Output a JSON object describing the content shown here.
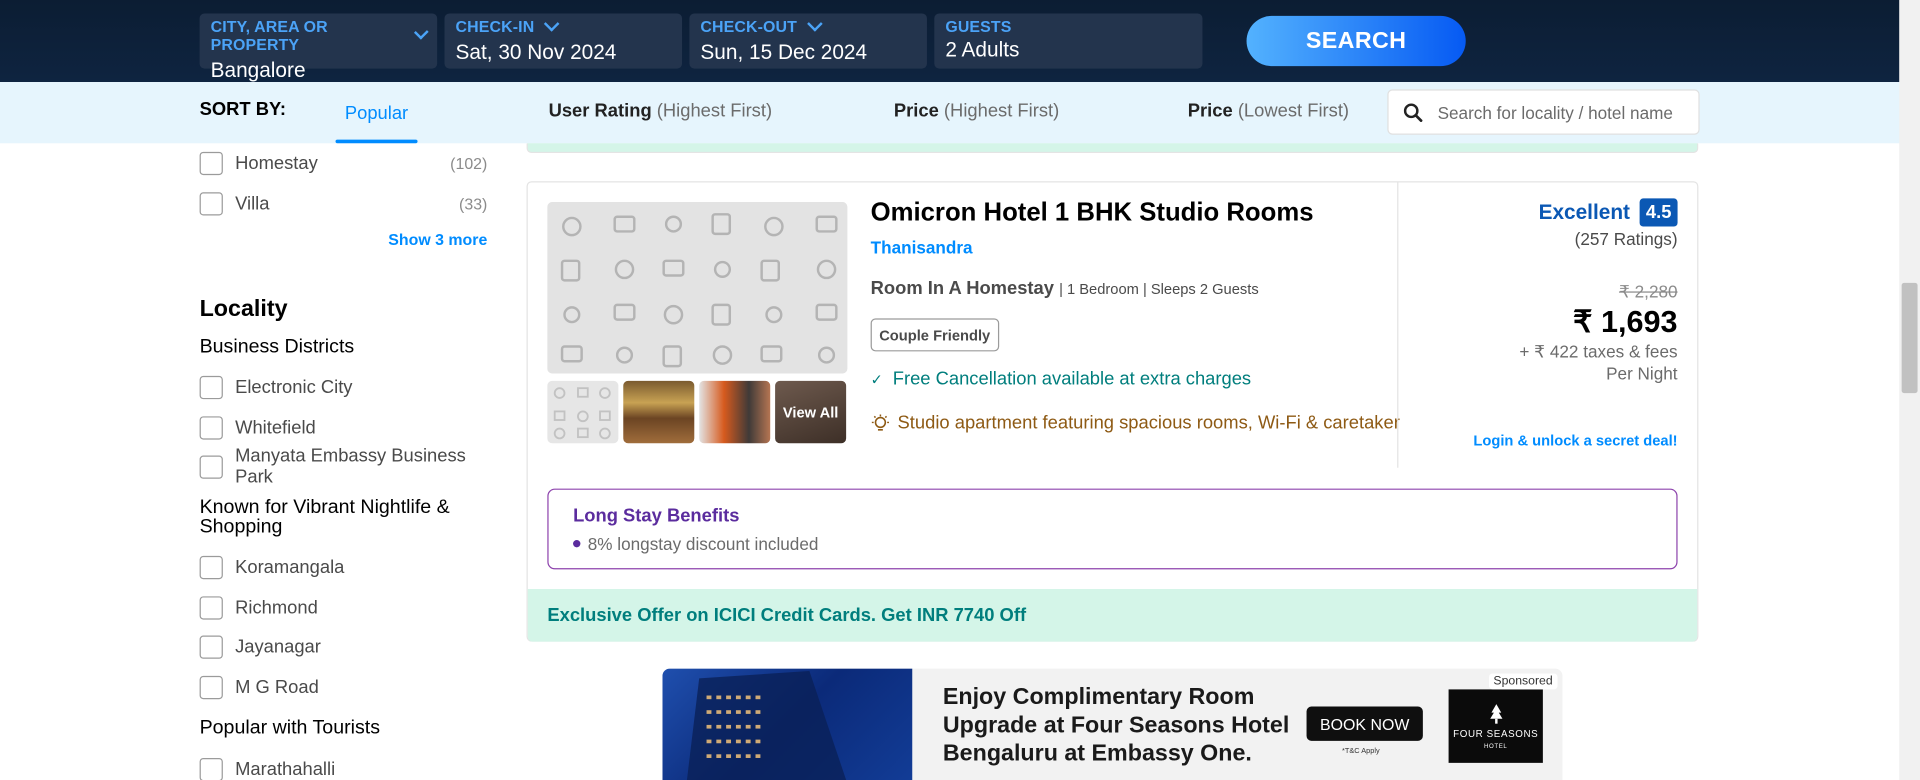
{
  "search_bar": {
    "city": {
      "label": "CITY, AREA OR PROPERTY",
      "value": "Bangalore"
    },
    "checkin": {
      "label": "CHECK-IN",
      "value": "Sat, 30 Nov 2024"
    },
    "checkout": {
      "label": "CHECK-OUT",
      "value": "Sun, 15 Dec 2024"
    },
    "guests": {
      "label": "GUESTS",
      "value": "2 Adults"
    },
    "search_label": "SEARCH"
  },
  "sort_bar": {
    "title": "SORT BY:",
    "active": "Popular",
    "options": [
      {
        "main": "User Rating",
        "sub": "(Highest First)"
      },
      {
        "main": "Price",
        "sub": "(Highest First)"
      },
      {
        "main": "Price",
        "sub": "(Lowest First)"
      }
    ],
    "search_placeholder": "Search for locality / hotel name"
  },
  "sidebar": {
    "property_types": [
      {
        "label": "Homestay",
        "count": "(102)"
      },
      {
        "label": "Villa",
        "count": "(33)"
      }
    ],
    "show_more": "Show 3 more",
    "locality_title": "Locality",
    "groups": [
      {
        "title": "Business Districts",
        "items": [
          "Electronic City",
          "Whitefield",
          "Manyata Embassy Business Park"
        ]
      },
      {
        "title": "Known for Vibrant Nightlife & Shopping",
        "items": [
          "Koramangala",
          "Richmond",
          "Jayanagar",
          "M G Road"
        ]
      },
      {
        "title": "Popular with Tourists",
        "items": [
          "Marathahalli"
        ]
      }
    ]
  },
  "hotel": {
    "name": "Omicron Hotel 1 BHK Studio Rooms",
    "locality": "Thanisandra",
    "room_type": "Room In A Homestay",
    "room_meta": "| 1 Bedroom | Sleeps 2 Guests",
    "tag": "Couple Friendly",
    "cancellation": "Free Cancellation available at extra charges",
    "highlight": "Studio apartment featuring spacious rooms, Wi-Fi & caretaker",
    "view_all": "View All",
    "rating_word": "Excellent",
    "rating": "4.5",
    "rating_count": "(257 Ratings)",
    "original_price": "₹ 2,280",
    "price": "₹ 1,693",
    "taxes": "+ ₹ 422 taxes & fees",
    "per_night": "Per Night",
    "login_deal": "Login & unlock a secret deal!",
    "long_stay_title": "Long Stay Benefits",
    "long_stay_item": "8% longstay discount included",
    "offer": "Exclusive Offer on ICICI Credit Cards. Get INR 7740 Off"
  },
  "ad": {
    "headline": "Enjoy Complimentary Room Upgrade at Four Seasons Hotel Bengaluru at Embassy One.",
    "button": "BOOK NOW",
    "tc": "*T&C Apply",
    "sponsored": "Sponsored",
    "logo_line1": "FOUR SEASONS",
    "logo_line2": "HOTEL"
  },
  "colors": {
    "accent": "#008cff",
    "header_bg": "#0c1d33",
    "rating": "#0b58b4",
    "offer_green": "#007e7d"
  }
}
